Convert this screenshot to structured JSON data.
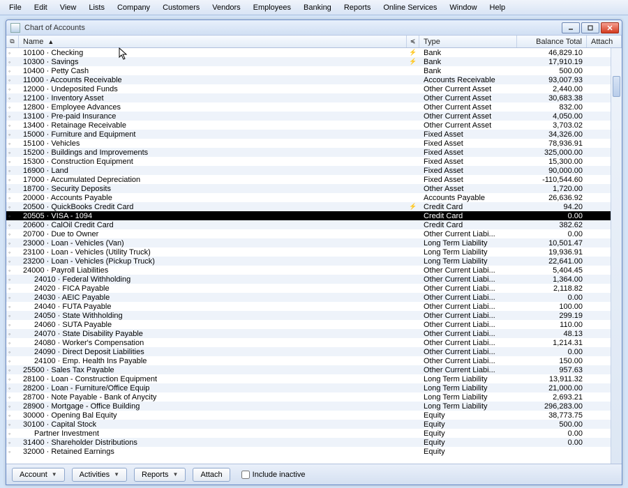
{
  "menubar": [
    "File",
    "Edit",
    "View",
    "Lists",
    "Company",
    "Customers",
    "Vendors",
    "Employees",
    "Banking",
    "Reports",
    "Online Services",
    "Window",
    "Help"
  ],
  "window": {
    "title": "Chart of Accounts"
  },
  "columns": {
    "name": "Name",
    "type": "Type",
    "balance": "Balance Total",
    "attach": "Attach"
  },
  "bottom": {
    "account_btn": "Account",
    "activities_btn": "Activities",
    "reports_btn": "Reports",
    "attach_btn": "Attach",
    "include_inactive": "Include inactive"
  },
  "selected_index": 18,
  "accounts": [
    {
      "name": "10100 · Checking",
      "type": "Bank",
      "balance": "46,829.10",
      "lightning": true,
      "expand": true
    },
    {
      "name": "10300 · Savings",
      "type": "Bank",
      "balance": "17,910.19",
      "lightning": true,
      "expand": true
    },
    {
      "name": "10400 · Petty Cash",
      "type": "Bank",
      "balance": "500.00",
      "expand": true
    },
    {
      "name": "11000 · Accounts Receivable",
      "type": "Accounts Receivable",
      "balance": "93,007.93",
      "expand": true
    },
    {
      "name": "12000 · Undeposited Funds",
      "type": "Other Current Asset",
      "balance": "2,440.00",
      "expand": true
    },
    {
      "name": "12100 · Inventory Asset",
      "type": "Other Current Asset",
      "balance": "30,683.38",
      "expand": true
    },
    {
      "name": "12800 · Employee Advances",
      "type": "Other Current Asset",
      "balance": "832.00",
      "expand": true
    },
    {
      "name": "13100 · Pre-paid Insurance",
      "type": "Other Current Asset",
      "balance": "4,050.00",
      "expand": true
    },
    {
      "name": "13400 · Retainage Receivable",
      "type": "Other Current Asset",
      "balance": "3,703.02",
      "expand": true
    },
    {
      "name": "15000 · Furniture and Equipment",
      "type": "Fixed Asset",
      "balance": "34,326.00",
      "expand": true
    },
    {
      "name": "15100 · Vehicles",
      "type": "Fixed Asset",
      "balance": "78,936.91",
      "expand": true
    },
    {
      "name": "15200 · Buildings and Improvements",
      "type": "Fixed Asset",
      "balance": "325,000.00",
      "expand": true
    },
    {
      "name": "15300 · Construction Equipment",
      "type": "Fixed Asset",
      "balance": "15,300.00",
      "expand": true
    },
    {
      "name": "16900 · Land",
      "type": "Fixed Asset",
      "balance": "90,000.00",
      "expand": true
    },
    {
      "name": "17000 · Accumulated Depreciation",
      "type": "Fixed Asset",
      "balance": "-110,544.60",
      "expand": true
    },
    {
      "name": "18700 · Security Deposits",
      "type": "Other Asset",
      "balance": "1,720.00",
      "expand": true
    },
    {
      "name": "20000 · Accounts Payable",
      "type": "Accounts Payable",
      "balance": "26,636.92",
      "expand": true
    },
    {
      "name": "20500 · QuickBooks Credit Card",
      "type": "Credit Card",
      "balance": "94.20",
      "lightning": true,
      "expand": true
    },
    {
      "name": "20505 · VISA - 1094",
      "type": "Credit Card",
      "balance": "0.00",
      "expand": true
    },
    {
      "name": "20600 · CalOil Credit Card",
      "type": "Credit Card",
      "balance": "382.62",
      "expand": true
    },
    {
      "name": "20700 · Due to Owner",
      "type": "Other Current Liabi...",
      "balance": "0.00",
      "expand": true
    },
    {
      "name": "23000 · Loan - Vehicles (Van)",
      "type": "Long Term Liability",
      "balance": "10,501.47",
      "expand": true
    },
    {
      "name": "23100 · Loan - Vehicles (Utility Truck)",
      "type": "Long Term Liability",
      "balance": "19,936.91",
      "expand": true
    },
    {
      "name": "23200 · Loan - Vehicles (Pickup Truck)",
      "type": "Long Term Liability",
      "balance": "22,641.00",
      "expand": true
    },
    {
      "name": "24000 · Payroll Liabilities",
      "type": "Other Current Liabi...",
      "balance": "5,404.45",
      "expand": true
    },
    {
      "name": "24010 · Federal Withholding",
      "type": "Other Current Liabi...",
      "balance": "1,364.00",
      "indent": 1,
      "expand": true
    },
    {
      "name": "24020 · FICA Payable",
      "type": "Other Current Liabi...",
      "balance": "2,118.82",
      "indent": 1,
      "expand": true
    },
    {
      "name": "24030 · AEIC Payable",
      "type": "Other Current Liabi...",
      "balance": "0.00",
      "indent": 1,
      "expand": true
    },
    {
      "name": "24040 · FUTA Payable",
      "type": "Other Current Liabi...",
      "balance": "100.00",
      "indent": 1,
      "expand": true
    },
    {
      "name": "24050 · State Withholding",
      "type": "Other Current Liabi...",
      "balance": "299.19",
      "indent": 1,
      "expand": true
    },
    {
      "name": "24060 · SUTA Payable",
      "type": "Other Current Liabi...",
      "balance": "110.00",
      "indent": 1,
      "expand": true
    },
    {
      "name": "24070 · State Disability Payable",
      "type": "Other Current Liabi...",
      "balance": "48.13",
      "indent": 1,
      "expand": true
    },
    {
      "name": "24080 · Worker's Compensation",
      "type": "Other Current Liabi...",
      "balance": "1,214.31",
      "indent": 1,
      "expand": true
    },
    {
      "name": "24090 · Direct Deposit Liabilities",
      "type": "Other Current Liabi...",
      "balance": "0.00",
      "indent": 1,
      "expand": true
    },
    {
      "name": "24100 · Emp. Health Ins Payable",
      "type": "Other Current Liabi...",
      "balance": "150.00",
      "indent": 1,
      "expand": true
    },
    {
      "name": "25500 · Sales Tax Payable",
      "type": "Other Current Liabi...",
      "balance": "957.63",
      "expand": true
    },
    {
      "name": "28100 · Loan - Construction Equipment",
      "type": "Long Term Liability",
      "balance": "13,911.32",
      "expand": true
    },
    {
      "name": "28200 · Loan - Furniture/Office Equip",
      "type": "Long Term Liability",
      "balance": "21,000.00",
      "expand": true
    },
    {
      "name": "28700 · Note Payable - Bank of Anycity",
      "type": "Long Term Liability",
      "balance": "2,693.21",
      "expand": true
    },
    {
      "name": "28900 · Mortgage - Office Building",
      "type": "Long Term Liability",
      "balance": "296,283.00",
      "expand": true
    },
    {
      "name": "30000 · Opening Bal Equity",
      "type": "Equity",
      "balance": "38,773.75",
      "expand": true
    },
    {
      "name": "30100 · Capital Stock",
      "type": "Equity",
      "balance": "500.00",
      "expand": true
    },
    {
      "name": "Partner Investment",
      "type": "Equity",
      "balance": "0.00",
      "indent": 1,
      "expand": true
    },
    {
      "name": "31400 · Shareholder Distributions",
      "type": "Equity",
      "balance": "0.00",
      "expand": true
    },
    {
      "name": "32000 · Retained Earnings",
      "type": "Equity",
      "balance": "",
      "expand": true
    }
  ]
}
